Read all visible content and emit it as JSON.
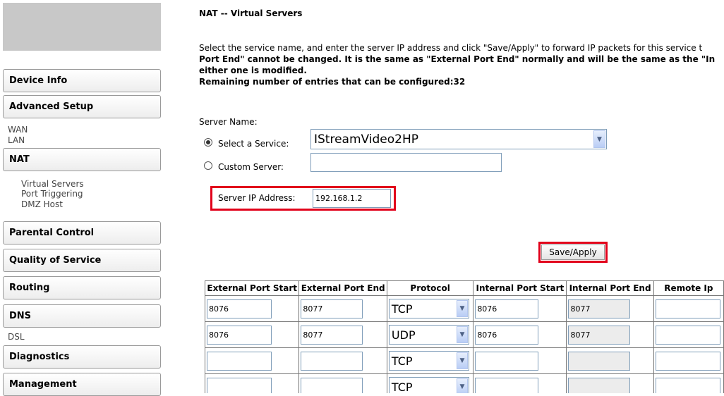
{
  "sidebar": {
    "device_info": "Device Info",
    "advanced_setup": "Advanced Setup",
    "wan": "WAN",
    "lan": "LAN",
    "nat": "NAT",
    "virtual_servers": "Virtual Servers",
    "port_triggering": "Port Triggering",
    "dmz_host": "DMZ Host",
    "parental_control": "Parental Control",
    "quality_of_service": "Quality of Service",
    "routing": "Routing",
    "dns": "DNS",
    "dsl": "DSL",
    "diagnostics": "Diagnostics",
    "management": "Management"
  },
  "main": {
    "title": "NAT -- Virtual Servers",
    "desc_line1": "Select the service name, and enter the server IP address and click \"Save/Apply\" to forward IP packets for this service t",
    "desc_line2": "Port End\" cannot be changed. It is the same as \"External Port End\" normally and will be the same as the \"In",
    "desc_line3": "either one is modified.",
    "desc_line4": "Remaining number of entries that can be configured:32",
    "server_name_label": "Server Name:",
    "select_service_label": "Select a Service:",
    "selected_service": "IStreamVideo2HP",
    "custom_server_label": "Custom Server:",
    "custom_server_value": "",
    "server_ip_label": "Server IP Address:",
    "server_ip_value": "192.168.1.2",
    "save_apply": "Save/Apply"
  },
  "table": {
    "headers": [
      "External Port Start",
      "External Port End",
      "Protocol",
      "Internal Port Start",
      "Internal Port End",
      "Remote Ip"
    ],
    "rows": [
      {
        "ext_start": "8076",
        "ext_end": "8077",
        "protocol": "TCP",
        "int_start": "8076",
        "int_end": "8077",
        "remote_ip": ""
      },
      {
        "ext_start": "8076",
        "ext_end": "8077",
        "protocol": "UDP",
        "int_start": "8076",
        "int_end": "8077",
        "remote_ip": ""
      },
      {
        "ext_start": "",
        "ext_end": "",
        "protocol": "TCP",
        "int_start": "",
        "int_end": "",
        "remote_ip": ""
      },
      {
        "ext_start": "",
        "ext_end": "",
        "protocol": "TCP",
        "int_start": "",
        "int_end": "",
        "remote_ip": ""
      }
    ]
  },
  "colors": {
    "highlight_red": "#e1001a",
    "input_border": "#7f9db9"
  },
  "icons": {
    "dropdown": "chevron-down-icon",
    "radio": "radio-icon"
  }
}
